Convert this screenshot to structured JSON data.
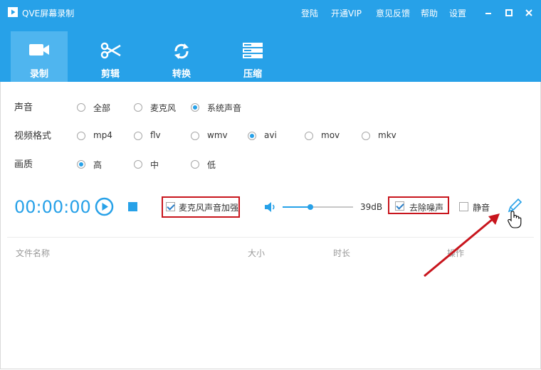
{
  "app": {
    "title": "QVE屏幕录制"
  },
  "topmenu": {
    "login": "登陆",
    "vip": "开通VIP",
    "feedback": "意见反馈",
    "help": "帮助",
    "settings": "设置"
  },
  "tabs": [
    {
      "label": "录制",
      "icon": "video-camera-icon",
      "active": true
    },
    {
      "label": "剪辑",
      "icon": "scissors-icon",
      "active": false
    },
    {
      "label": "转换",
      "icon": "convert-icon",
      "active": false
    },
    {
      "label": "压缩",
      "icon": "compress-icon",
      "active": false
    }
  ],
  "settings": {
    "sound": {
      "label": "声音",
      "options": [
        "全部",
        "麦克风",
        "系统声音"
      ],
      "selected": "系统声音"
    },
    "format": {
      "label": "视频格式",
      "options": [
        "mp4",
        "flv",
        "wmv",
        "avi",
        "mov",
        "mkv"
      ],
      "selected": "avi"
    },
    "quality": {
      "label": "画质",
      "options": [
        "高",
        "中",
        "低"
      ],
      "selected": "高"
    }
  },
  "recorder": {
    "timer": "00:00:00",
    "mic_boost_label": "麦克风声音加强",
    "mic_boost_checked": true,
    "volume_text": "39dB",
    "volume_level_fraction": 0.39,
    "denoise_label": "去除噪声",
    "denoise_checked": true,
    "mute_label": "静音",
    "mute_checked": false
  },
  "filelist": {
    "columns": [
      "文件名称",
      "大小",
      "时长",
      "操作"
    ]
  },
  "colors": {
    "accent": "#27a1e8",
    "highlight_box": "#c8151d",
    "arrow": "#c8151d"
  }
}
